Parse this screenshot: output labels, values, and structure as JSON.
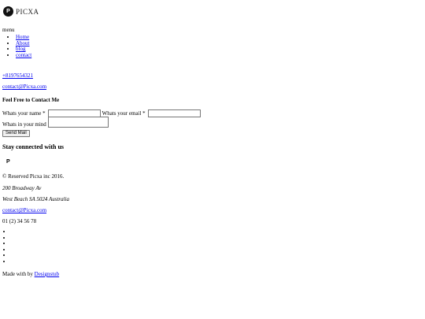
{
  "brand": {
    "logo_letter": "P",
    "name": "PICXA"
  },
  "menu": {
    "label": "menu",
    "items": [
      {
        "label": "Home"
      },
      {
        "label": "About"
      },
      {
        "label": "blog"
      },
      {
        "label": "contact"
      }
    ]
  },
  "contact_info": {
    "phone": "+8197654321",
    "email": "contact@Picxa.com"
  },
  "contact_form": {
    "heading": "Feel Free to Contact Me",
    "name_label": "Whats your name *",
    "name_value": "",
    "email_label": "Whats your email *",
    "email_value": "",
    "mind_label": "Whats in your mind",
    "mind_value": "",
    "submit_label": "Send Mail"
  },
  "footer": {
    "stay_heading": "Stay connected with us",
    "logo_letter": "P",
    "copyright": "© Reserved Picxa inc 2016.",
    "address_line1": "200 Broadway Av",
    "address_line2": "West Beach SA 5024 Australia",
    "email": "contact@Picxa.com",
    "phone": "01 (2) 34 56 78",
    "social_items": [
      "",
      "",
      "",
      "",
      "",
      ""
    ],
    "made_with_prefix": "Made with by",
    "made_with_link": "Designstub"
  }
}
